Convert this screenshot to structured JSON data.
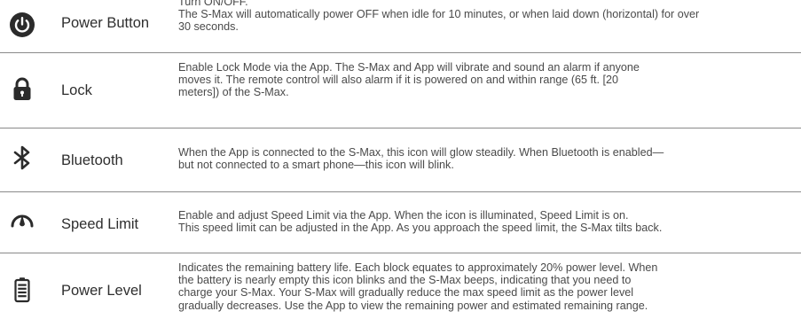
{
  "rows": [
    {
      "icon": "power-icon",
      "name": "Power Button",
      "description_lines": [
        "Turn ON/OFF.",
        "The S-Max will automatically power OFF when idle for 10 minutes, or when laid down (horizontal) for over",
        "30 seconds."
      ]
    },
    {
      "icon": "lock-icon",
      "name": "Lock",
      "description_lines": [
        "Enable Lock Mode via the App. The S-Max and App will vibrate and sound an alarm if anyone",
        "moves it. The remote control will also alarm if it is powered on and within range (65 ft. [20",
        "meters]) of the S-Max."
      ]
    },
    {
      "icon": "bluetooth-icon",
      "name": "Bluetooth",
      "description_lines": [
        "When the App is connected to the S-Max, this icon will glow steadily. When Bluetooth is enabled—",
        "but not connected to a smart phone—this icon will blink."
      ]
    },
    {
      "icon": "speedometer-icon",
      "name": "Speed Limit",
      "description_lines": [
        "Enable and adjust Speed Limit via the App. When the icon is illuminated, Speed Limit is on.",
        "This speed limit can be adjusted in the App. As you approach the speed limit, the S-Max tilts back."
      ]
    },
    {
      "icon": "battery-icon",
      "name": "Power Level",
      "description_lines": [
        "Indicates the remaining battery life. Each block equates to approximately 20% power level. When",
        "the battery is nearly empty this icon blinks and the S-Max beeps, indicating that you need to",
        "charge your S-Max. Your S-Max will gradually reduce the max speed limit as the power level",
        "gradually decreases. Use the App to view the remaining power and estimated remaining range."
      ]
    }
  ]
}
